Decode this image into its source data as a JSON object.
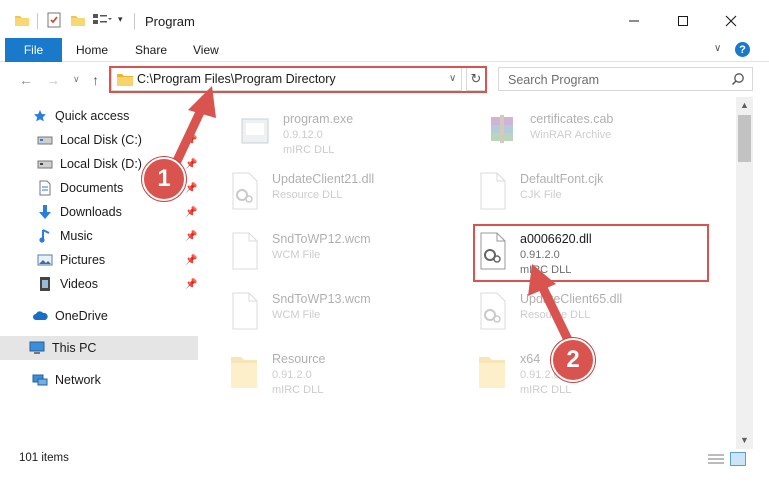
{
  "window": {
    "title": "Program",
    "minimize_icon": "minimize-icon",
    "maximize_icon": "maximize-icon",
    "close_icon": "close-icon"
  },
  "ribbon": {
    "tabs": [
      "File",
      "Home",
      "Share",
      "View"
    ],
    "accent": "#1979ca"
  },
  "navigation": {
    "address": "C:\\Program Files\\Program Directory",
    "search_placeholder": "Search Program"
  },
  "sidebar": {
    "items": [
      {
        "label": "Quick access",
        "icon": "star-icon"
      },
      {
        "label": "Local Disk (C:)",
        "icon": "drive-icon",
        "pinned": true
      },
      {
        "label": "Local Disk (D:)",
        "icon": "drive-icon",
        "pinned": true
      },
      {
        "label": "Documents",
        "icon": "documents-icon",
        "pinned": true
      },
      {
        "label": "Downloads",
        "icon": "download-icon",
        "pinned": true
      },
      {
        "label": "Music",
        "icon": "music-icon",
        "pinned": true
      },
      {
        "label": "Pictures",
        "icon": "pictures-icon",
        "pinned": true
      },
      {
        "label": "Videos",
        "icon": "videos-icon",
        "pinned": true
      },
      {
        "label": "OneDrive",
        "icon": "cloud-icon"
      },
      {
        "label": "This PC",
        "icon": "computer-icon",
        "selected": true
      },
      {
        "label": "Network",
        "icon": "network-icon"
      }
    ]
  },
  "files": [
    {
      "name": "program.exe",
      "line1": "0.9.12.0",
      "line2": "mIRC DLL",
      "icon": "exe-icon"
    },
    {
      "name": "certificates.cab",
      "line1": "WinRAR Archive",
      "line2": "",
      "icon": "archive-icon"
    },
    {
      "name": "UpdateClient21.dll",
      "line1": "Resource DLL",
      "line2": "",
      "icon": "dll-icon"
    },
    {
      "name": "DefaultFont.cjk",
      "line1": "CJK File",
      "line2": "",
      "icon": "file-icon"
    },
    {
      "name": "SndToWP12.wcm",
      "line1": "WCM File",
      "line2": "",
      "icon": "file-icon"
    },
    {
      "name": "a0006620.dll",
      "line1": "0.91.2.0",
      "line2": "mIRC DLL",
      "icon": "dll-icon"
    },
    {
      "name": "SndToWP13.wcm",
      "line1": "WCM File",
      "line2": "",
      "icon": "file-icon"
    },
    {
      "name": "UpdateClient65.dll",
      "line1": "Resource DLL",
      "line2": "",
      "icon": "dll-icon"
    },
    {
      "name": "Resource",
      "line1": "0.91.2.0",
      "line2": "mIRC DLL",
      "icon": "folder-icon"
    },
    {
      "name": "x64",
      "line1": "0.91.2.0",
      "line2": "mIRC DLL",
      "icon": "folder-icon"
    }
  ],
  "status": {
    "item_count": "101 items"
  },
  "annotations": {
    "step1": "1",
    "step2": "2",
    "color": "#d9534f"
  }
}
